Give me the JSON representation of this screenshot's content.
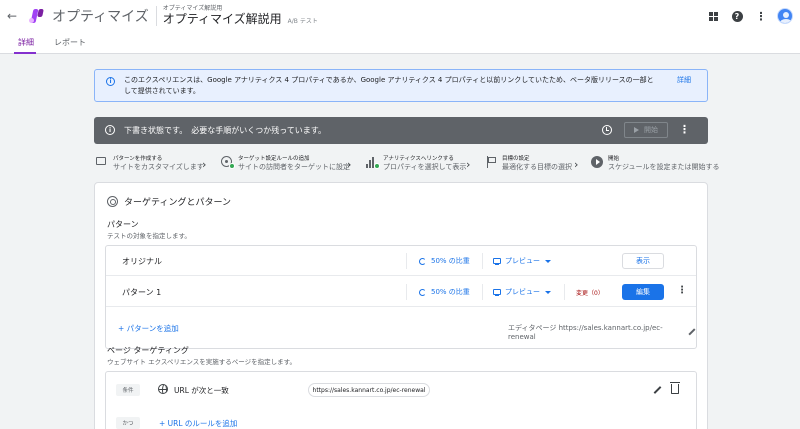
{
  "header": {
    "brand": "オプティマイズ",
    "crumb_small": "オプティマイズ解説用",
    "title": "オプティマイズ解説用",
    "type": "A/B テスト"
  },
  "tabs": [
    {
      "label": "詳細",
      "active": true
    },
    {
      "label": "レポート",
      "active": false
    }
  ],
  "info_banner": {
    "text": "このエクスペリエンスは、Google アナリティクス 4 プロパティであるか、Google アナリティクス 4 プロパティと以前リンクしていたため、ベータ版リリースの一部として提供されています。",
    "link": "詳細"
  },
  "draft_bar": {
    "text": "下書き状態です。　必要な手順がいくつか残っています。",
    "start_label": "開始"
  },
  "steps": [
    {
      "title": "パターンを作成する",
      "sub": "サイトをカスタマイズします",
      "done": false
    },
    {
      "title": "ターゲット設定ルールの追加",
      "sub": "サイトの訪問者をターゲットに設定",
      "done": true
    },
    {
      "title": "アナリティクスへリンクする",
      "sub": "プロパティを選択して表示",
      "done": true
    },
    {
      "title": "目標の設定",
      "sub": "最適化する目標の選択",
      "done": false
    },
    {
      "title": "開始",
      "sub": "スケジュールを設定または開始する",
      "done": false
    }
  ],
  "card": {
    "title": "ターゲティングとパターン",
    "variants_title": "パターン",
    "variants_sub": "テストの対象を指定します。",
    "variants": [
      {
        "name": "オリジナル",
        "ratio": "50% の比重",
        "preview": "プレビュー",
        "changes": "",
        "button": "表示"
      },
      {
        "name": "パターン 1",
        "ratio": "50% の比重",
        "preview": "プレビュー",
        "changes": "変更（0）",
        "button": "編集"
      }
    ],
    "add_variant": "+ パターンを追加",
    "editor_page": "エディタページ https://sales.kannart.co.jp/ec-renewal",
    "page_targeting_title": "ページ ターゲティング",
    "page_targeting_sub": "ウェブサイト エクスペリエンスを実施するページを指定します。",
    "rule": {
      "chip": "条件",
      "label": "URL が次と一致",
      "value": "https://sales.kannart.co.jp/ec-renewal"
    },
    "and_chip": "かつ",
    "add_rule": "+ URL のルールを追加"
  },
  "colors": {
    "accent": "#8430ce",
    "link": "#1a73e8",
    "draft_bg": "#5f6368",
    "info_bg": "#e8f0fe"
  }
}
